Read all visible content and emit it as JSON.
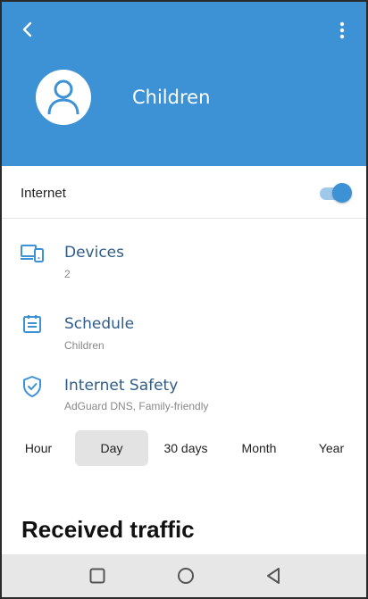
{
  "header": {
    "title": "Children",
    "back_icon": "chevron-left-icon",
    "more_icon": "more-vert-icon",
    "avatar_icon": "person-icon",
    "color": "#3d92d6"
  },
  "internet": {
    "label": "Internet",
    "enabled": true,
    "accent": "#3d92d6"
  },
  "menu": [
    {
      "title": "Devices",
      "subtitle": "2",
      "icon": "devices-icon"
    },
    {
      "title": "Schedule",
      "subtitle": "Children",
      "icon": "schedule-icon"
    },
    {
      "title": "Internet Safety",
      "subtitle": "AdGuard DNS, Family-friendly",
      "icon": "shield-check-icon"
    }
  ],
  "periods": {
    "options": [
      "Hour",
      "Day",
      "30 days",
      "Month",
      "Year"
    ],
    "selected": "Day"
  },
  "traffic": {
    "title": "Received traffic"
  },
  "navbar": {
    "buttons": [
      "recents-square-icon",
      "home-circle-icon",
      "back-triangle-icon"
    ]
  }
}
